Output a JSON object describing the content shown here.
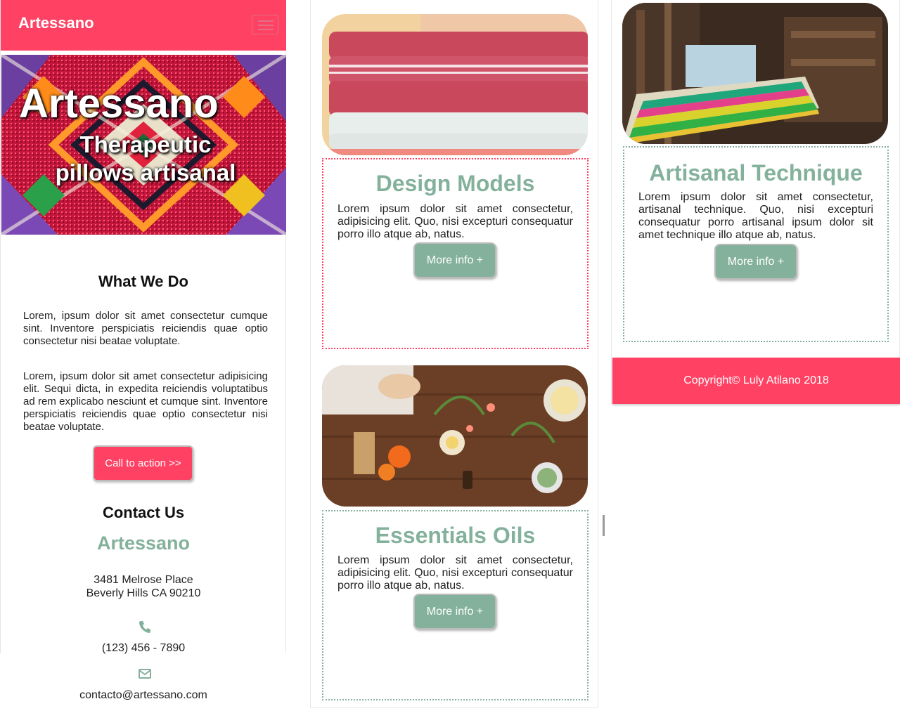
{
  "header": {
    "brand": "Artessano"
  },
  "hero": {
    "title": "Artessano",
    "subtitle_line1": "Therapeutic",
    "subtitle_line2": "pillows artisanal"
  },
  "what_we_do": {
    "heading": "What We Do",
    "para1": "Lorem, ipsum dolor sit amet consectetur cumque sint. Inventore perspiciatis reiciendis quae optio consectetur nisi beatae voluptate.",
    "para2": "Lorem, ipsum dolor sit amet consectetur adipisicing elit. Sequi dicta, in expedita reiciendis voluptatibus ad rem explicabo nesciunt et cumque sint. Inventore perspiciatis reiciendis quae optio consectetur nisi beatae voluptate.",
    "cta_label": "Call to action >>"
  },
  "contact": {
    "heading": "Contact Us",
    "brand": "Artessano",
    "address_line1": "3481 Melrose Place",
    "address_line2": "Beverly Hills CA 90210",
    "phone": "(123) 456 - 7890",
    "email": "contacto@artessano.com"
  },
  "cards": [
    {
      "title": "Design Models",
      "text": "Lorem ipsum dolor sit amet consectetur, adipisicing elit. Quo, nisi excepturi consequatur porro illo atque ab, natus.",
      "button": "More info +",
      "border_color": "#ff4264"
    },
    {
      "title": "Essentials Oils",
      "text": "Lorem ipsum dolor sit amet consectetur, adipisicing elit. Quo, nisi excepturi consequatur porro illo atque ab, natus.",
      "button": "More info +",
      "border_color": "#84b19c"
    },
    {
      "title": "Artisanal Technique",
      "text": "Lorem ipsum dolor sit amet consectetur, artisanal technique. Quo, nisi excepturi consequatur porro artisanal ipsum dolor sit amet technique illo atque ab, natus.",
      "button": "More info +",
      "border_color": "#84b19c"
    }
  ],
  "footer": {
    "copyright": "Copyright© Luly Atilano 2018"
  },
  "colors": {
    "brand_pink": "#ff4264",
    "sage_green": "#84b19c"
  },
  "icons": [
    "menu-icon",
    "phone-icon",
    "envelope-icon"
  ]
}
